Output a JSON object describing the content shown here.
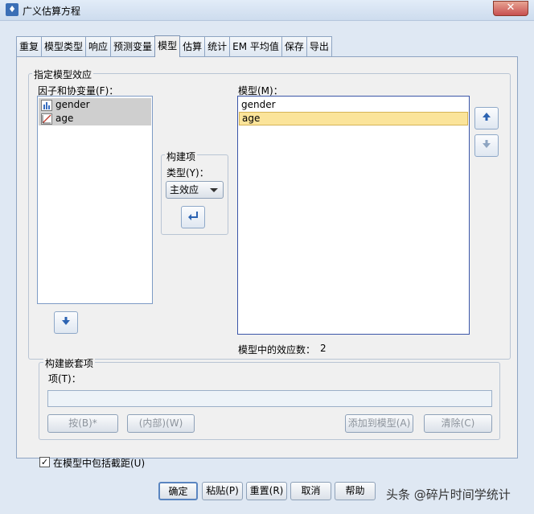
{
  "window": {
    "title": "广义估算方程",
    "close_label": "✕",
    "app_icon": "spss-dialog-icon"
  },
  "tabs": [
    "重复",
    "模型类型",
    "响应",
    "预测变量",
    "模型",
    "估算",
    "统计",
    "EM 平均值",
    "保存",
    "导出"
  ],
  "active_tab": "模型",
  "specify_group": {
    "label": "指定模型效应"
  },
  "factors": {
    "label": "因子和协变量(F)：",
    "items": [
      {
        "name": "gender",
        "icon": "nominal-variable-icon"
      },
      {
        "name": "age",
        "icon": "scale-variable-icon"
      }
    ]
  },
  "build_term": {
    "label": "构建项",
    "type_label": "类型(Y)：",
    "type_value": "主效应"
  },
  "model": {
    "label": "模型(M)：",
    "items": [
      "gender",
      "age"
    ],
    "selected": "age",
    "effect_count_label": "模型中的效应数：",
    "effect_count": "2"
  },
  "nested": {
    "label": "构建嵌套项",
    "term_label": "项(T)：",
    "term_value": "",
    "by_button": "按(B)*",
    "within_button": "(内部)(W)",
    "add_button": "添加到模型(A)",
    "clear_button": "清除(C)"
  },
  "intercept": {
    "label": "在模型中包括截距(U)",
    "checked": true
  },
  "buttons": {
    "ok": "确定",
    "paste": "粘贴(P)",
    "reset": "重置(R)",
    "cancel": "取消",
    "help": "帮助"
  },
  "watermark": "头条 @碎片时间学统计",
  "colors": {
    "selection_yellow": "#fbe49a",
    "arrow_blue": "#2c63b2",
    "list_border": "#7d9bc5"
  }
}
